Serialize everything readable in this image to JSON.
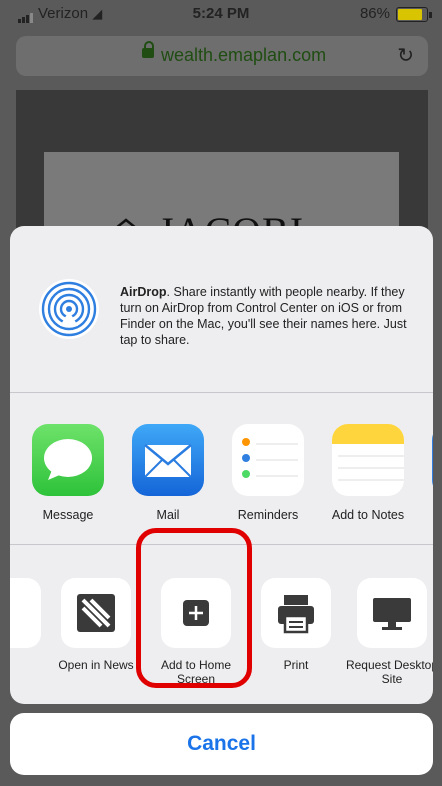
{
  "status": {
    "carrier": "Verizon",
    "time": "5:24 PM",
    "battery": "86%"
  },
  "browser": {
    "url": "wealth.emaplan.com"
  },
  "page": {
    "brand": "JACOBI"
  },
  "airdrop": {
    "title": "AirDrop",
    "text": ". Share instantly with people nearby. If they turn on AirDrop from Control Center on iOS or from Finder on the Mac, you'll see their names here. Just tap to share."
  },
  "apps": [
    {
      "label": "Message"
    },
    {
      "label": "Mail"
    },
    {
      "label": "Reminders"
    },
    {
      "label": "Add to Notes"
    }
  ],
  "actions": [
    {
      "label": "Open in News"
    },
    {
      "label": "Add to Home Screen"
    },
    {
      "label": "Print"
    },
    {
      "label": "Request Desktop Site"
    }
  ],
  "cancel_label": "Cancel",
  "colors": {
    "cancel": "#1a73e8",
    "highlight": "#e00000",
    "messages_green": "#4cd964",
    "mail_blue": "#1e88e5"
  }
}
